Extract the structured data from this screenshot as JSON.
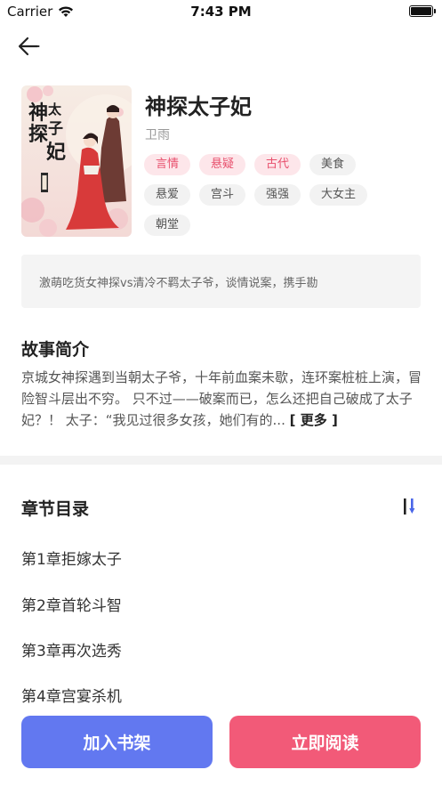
{
  "status_bar": {
    "carrier": "Carrier",
    "time": "7:43 PM",
    "battery_level": 1.0
  },
  "book": {
    "title": "神探太子妃",
    "author": "卫雨",
    "cover_text": "神太探子妃",
    "tags": [
      {
        "label": "言情",
        "highlighted": true
      },
      {
        "label": "悬疑",
        "highlighted": true
      },
      {
        "label": "古代",
        "highlighted": true
      },
      {
        "label": "美食",
        "highlighted": false
      },
      {
        "label": "悬爱",
        "highlighted": false
      },
      {
        "label": "宫斗",
        "highlighted": false
      },
      {
        "label": "强强",
        "highlighted": false
      },
      {
        "label": "大女主",
        "highlighted": false
      },
      {
        "label": "朝堂",
        "highlighted": false
      }
    ],
    "tagline": "激萌吃货女神探vs清冷不羁太子爷，谈情说案，携手勘"
  },
  "intro": {
    "heading": "故事简介",
    "text": "京城女神探遇到当朝太子爷，十年前血案未歇，连环案桩桩上演，冒险智斗层出不穷。 只不过——破案而已，怎么还把自己破成了太子妃？！ 太子：“我见过很多女孩，她们有的...",
    "more_label": "[ 更多 ]"
  },
  "chapters": {
    "heading": "章节目录",
    "items": [
      "第1章拒嫁太子",
      "第2章首轮斗智",
      "第3章再次选秀",
      "第4章宫宴杀机"
    ]
  },
  "actions": {
    "add_shelf_label": "加入书架",
    "read_label": "立即阅读"
  },
  "colors": {
    "accent_blue": "#6278f0",
    "accent_pink": "#f25a78",
    "tag_pink_bg": "#fde6ea",
    "tag_pink_text": "#e8506d"
  }
}
